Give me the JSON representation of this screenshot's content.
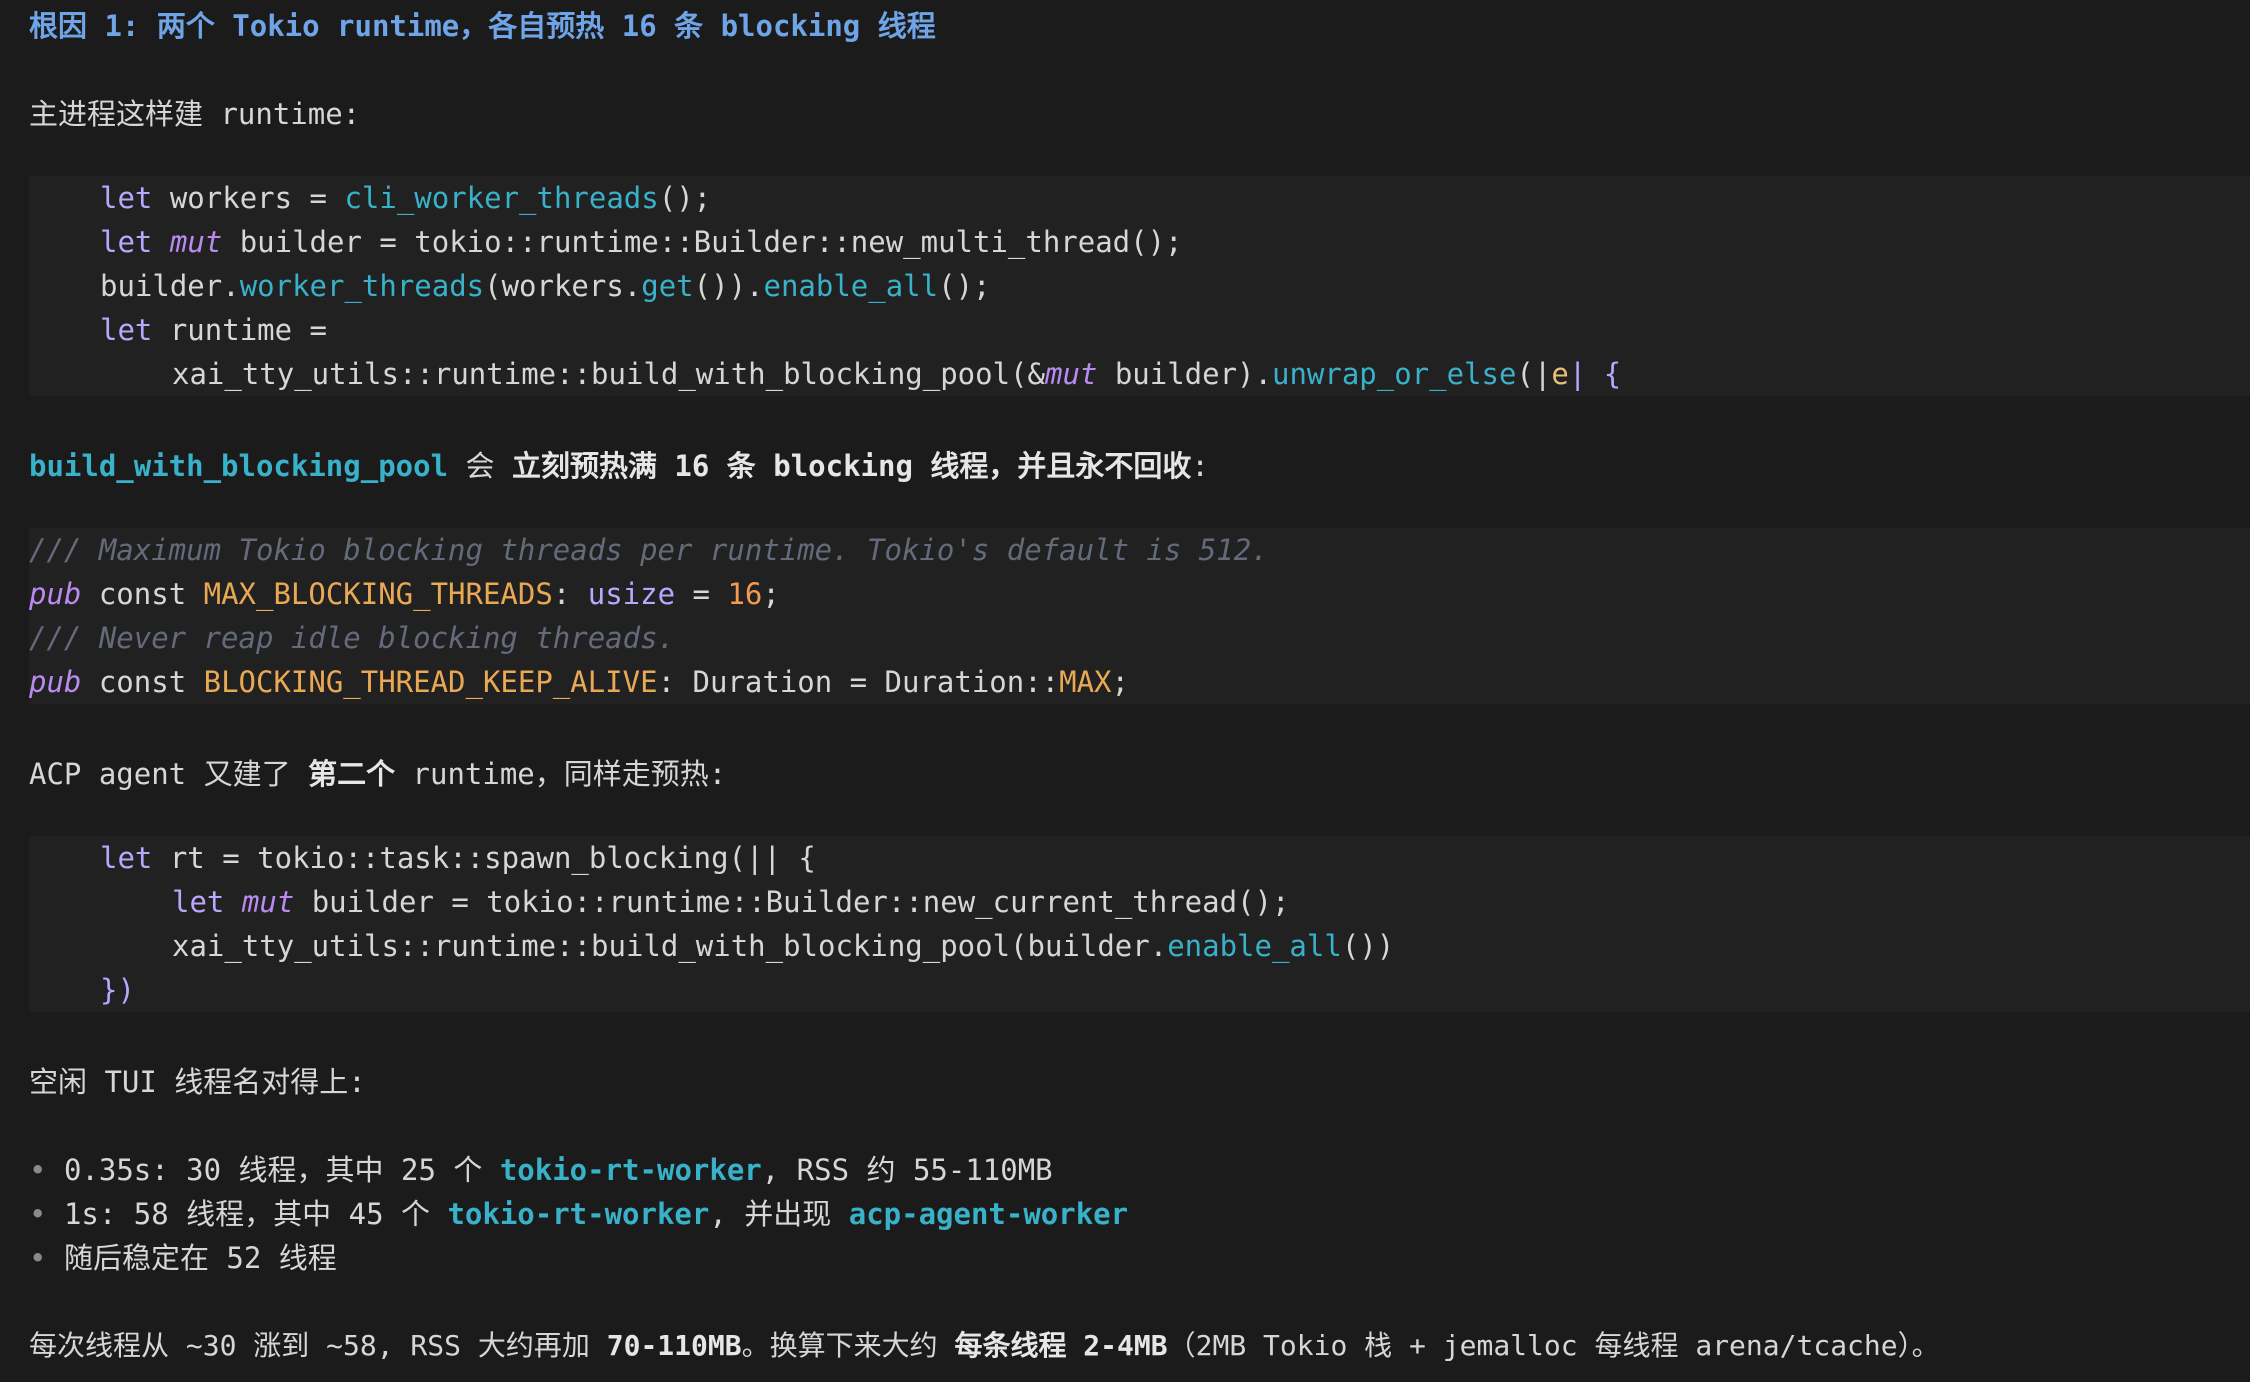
{
  "heading": "根因 1: 两个 Tokio runtime，各自预热 16 条 blocking 线程",
  "intro_1": "主进程这样建 runtime:",
  "code1": {
    "l1": {
      "kw": "let",
      "rest": " workers = ",
      "fn": "cli_worker_threads",
      "end": "();"
    },
    "l2": {
      "kw": "let",
      "mut": "mut",
      "rest": " builder = tokio::runtime::Builder::new_multi_thread();"
    },
    "l3": {
      "a": "builder.",
      "fn1": "worker_threads",
      "b": "(workers.",
      "fn2": "get",
      "c": "()).",
      "fn3": "enable_all",
      "d": "();"
    },
    "l4": {
      "kw": "let",
      "rest": " runtime ="
    },
    "l5": {
      "a": "xai_tty_utils::runtime::build_with_blocking_pool(&",
      "mut": "mut",
      "b": " builder).",
      "fn": "unwrap_or_else",
      "c": "(|",
      "e": "e",
      "d": "| {"
    }
  },
  "para2": {
    "fn": "build_with_blocking_pool",
    "mid": " 会 ",
    "bold": "立刻预热满 16 条 blocking 线程，并且永不回收",
    "end": ":"
  },
  "code2": {
    "c1": "/// Maximum Tokio blocking threads per runtime. Tokio's default is 512.",
    "l2": {
      "pub": "pub",
      "const_kw": " const ",
      "name": "MAX_BLOCKING_THREADS",
      "a": ": ",
      "type": "usize",
      "b": " = ",
      "num": "16",
      "c": ";"
    },
    "c3": "/// Never reap idle blocking threads.",
    "l4": {
      "pub": "pub",
      "const_kw": " const ",
      "name": "BLOCKING_THREAD_KEEP_ALIVE",
      "a": ": Duration = Duration::",
      "max": "MAX",
      "c": ";"
    }
  },
  "para3": {
    "a": "ACP agent 又建了 ",
    "bold": "第二个",
    "b": " runtime，同样走预热:"
  },
  "code3": {
    "l1": {
      "kw": "let",
      "rest": " rt = tokio::task::spawn_blocking(|| {"
    },
    "l2": {
      "kw": "let",
      "mut": "mut",
      "rest": " builder = tokio::runtime::Builder::new_current_thread();"
    },
    "l3": {
      "a": "xai_tty_utils::runtime::build_with_blocking_pool(builder.",
      "fn": "enable_all",
      "b": "())"
    },
    "l4": "})"
  },
  "para4": "空闲 TUI 线程名对得上:",
  "bullets": [
    {
      "a": "0.35s: 30 线程，其中 25 个 ",
      "link": "tokio-rt-worker",
      "b": ", RSS 约 55-110MB"
    },
    {
      "a": "1s: 58 线程，其中 45 个 ",
      "link": "tokio-rt-worker",
      "b": ", 并出现 ",
      "link2": "acp-agent-worker"
    },
    {
      "a": "随后稳定在 52 线程"
    }
  ],
  "bullet_glyph": "•",
  "para5": {
    "a": "每次线程从 ~30 涨到 ~58, RSS 大约再加 ",
    "bold1": "70-110MB",
    "b": "。换算下来大约 ",
    "bold2": "每条线程 2-4MB",
    "c": "（2MB Tokio 栈 + jemalloc 每线程 arena/tcache）。"
  }
}
